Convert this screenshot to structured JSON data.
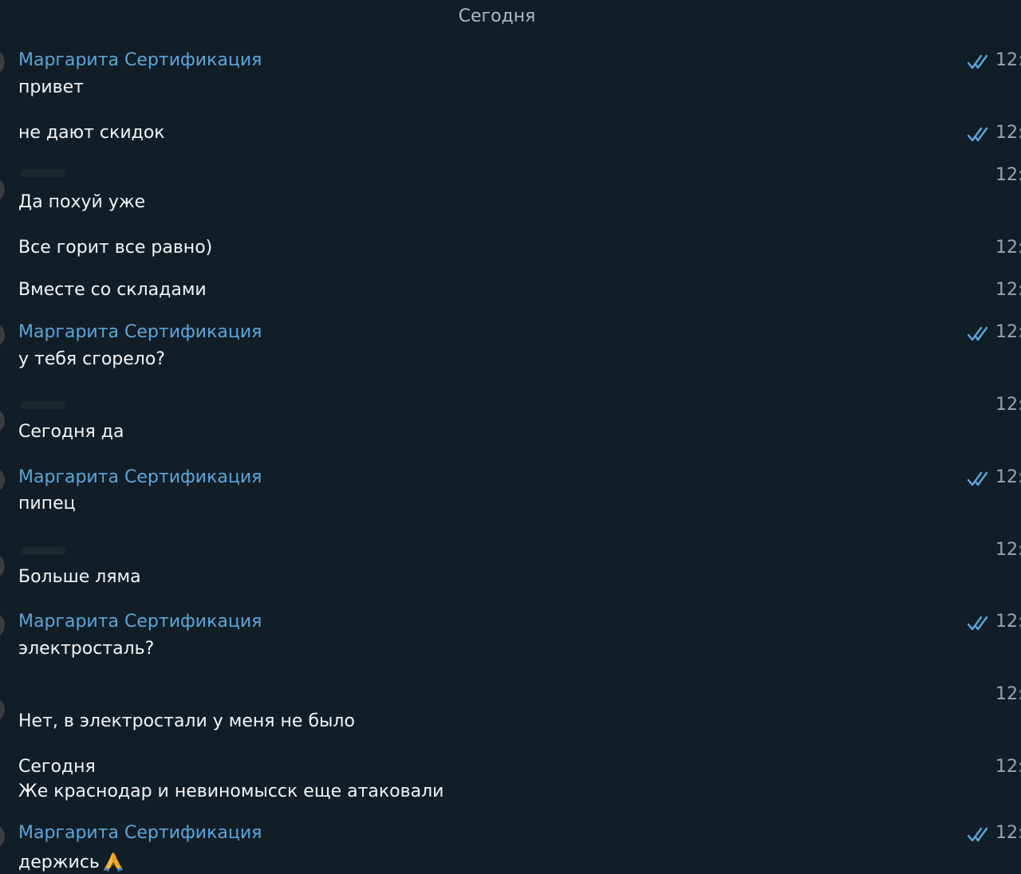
{
  "date_separator": "Сегодня",
  "messages": [
    {
      "sender": "Маргарита Сертификация",
      "text": "привет",
      "time": "12:",
      "read": true
    },
    {
      "text": "не дают скидок",
      "time": "12:",
      "read": true
    },
    {
      "text": "Да похуй уже",
      "time": "12:"
    },
    {
      "text": "Все горит все равно)",
      "time": "12:"
    },
    {
      "text": "Вместе со складами",
      "time": "12:"
    },
    {
      "sender": "Маргарита Сертификация",
      "text": "у тебя сгорело?",
      "time": "12:",
      "read": true
    },
    {
      "text": "Сегодня да",
      "time": "12:"
    },
    {
      "sender": "Маргарита Сертификация",
      "text": "пипец",
      "time": "12:",
      "read": true
    },
    {
      "text": "Больше ляма",
      "time": "12:"
    },
    {
      "sender": "Маргарита Сертификация",
      "text": "электросталь?",
      "time": "12:",
      "read": true
    },
    {
      "text": "Нет, в электростали у меня не было",
      "time": "12:"
    },
    {
      "text_lines": [
        "Сегодня",
        "Же краснодар и невиномысск еще атаковали"
      ],
      "time": "12:"
    },
    {
      "sender": "Маргарита Сертификация",
      "text": "держись",
      "emoji": "folded-hands",
      "time": "12:",
      "read": true
    }
  ],
  "colors": {
    "background": "#121e27",
    "sender_name": "#5aa6da",
    "message_text": "#f3f5f7",
    "time_text": "#9aa5af",
    "read_checks": "#5aa6da"
  }
}
